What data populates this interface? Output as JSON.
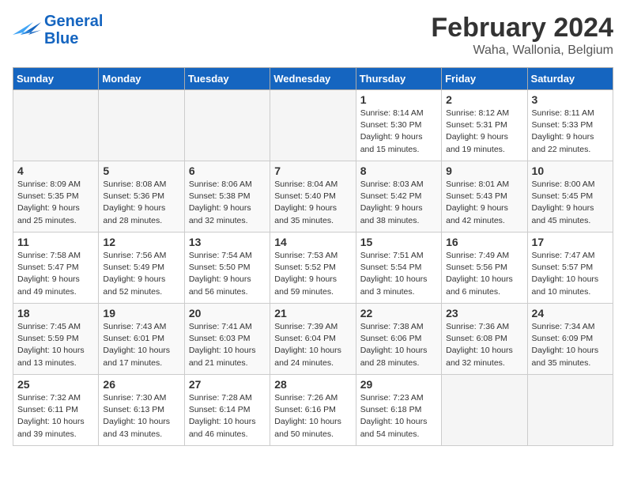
{
  "header": {
    "logo_line1": "General",
    "logo_line2": "Blue",
    "title": "February 2024",
    "subtitle": "Waha, Wallonia, Belgium"
  },
  "days_of_week": [
    "Sunday",
    "Monday",
    "Tuesday",
    "Wednesday",
    "Thursday",
    "Friday",
    "Saturday"
  ],
  "weeks": [
    [
      {
        "day": "",
        "info": ""
      },
      {
        "day": "",
        "info": ""
      },
      {
        "day": "",
        "info": ""
      },
      {
        "day": "",
        "info": ""
      },
      {
        "day": "1",
        "info": "Sunrise: 8:14 AM\nSunset: 5:30 PM\nDaylight: 9 hours\nand 15 minutes."
      },
      {
        "day": "2",
        "info": "Sunrise: 8:12 AM\nSunset: 5:31 PM\nDaylight: 9 hours\nand 19 minutes."
      },
      {
        "day": "3",
        "info": "Sunrise: 8:11 AM\nSunset: 5:33 PM\nDaylight: 9 hours\nand 22 minutes."
      }
    ],
    [
      {
        "day": "4",
        "info": "Sunrise: 8:09 AM\nSunset: 5:35 PM\nDaylight: 9 hours\nand 25 minutes."
      },
      {
        "day": "5",
        "info": "Sunrise: 8:08 AM\nSunset: 5:36 PM\nDaylight: 9 hours\nand 28 minutes."
      },
      {
        "day": "6",
        "info": "Sunrise: 8:06 AM\nSunset: 5:38 PM\nDaylight: 9 hours\nand 32 minutes."
      },
      {
        "day": "7",
        "info": "Sunrise: 8:04 AM\nSunset: 5:40 PM\nDaylight: 9 hours\nand 35 minutes."
      },
      {
        "day": "8",
        "info": "Sunrise: 8:03 AM\nSunset: 5:42 PM\nDaylight: 9 hours\nand 38 minutes."
      },
      {
        "day": "9",
        "info": "Sunrise: 8:01 AM\nSunset: 5:43 PM\nDaylight: 9 hours\nand 42 minutes."
      },
      {
        "day": "10",
        "info": "Sunrise: 8:00 AM\nSunset: 5:45 PM\nDaylight: 9 hours\nand 45 minutes."
      }
    ],
    [
      {
        "day": "11",
        "info": "Sunrise: 7:58 AM\nSunset: 5:47 PM\nDaylight: 9 hours\nand 49 minutes."
      },
      {
        "day": "12",
        "info": "Sunrise: 7:56 AM\nSunset: 5:49 PM\nDaylight: 9 hours\nand 52 minutes."
      },
      {
        "day": "13",
        "info": "Sunrise: 7:54 AM\nSunset: 5:50 PM\nDaylight: 9 hours\nand 56 minutes."
      },
      {
        "day": "14",
        "info": "Sunrise: 7:53 AM\nSunset: 5:52 PM\nDaylight: 9 hours\nand 59 minutes."
      },
      {
        "day": "15",
        "info": "Sunrise: 7:51 AM\nSunset: 5:54 PM\nDaylight: 10 hours\nand 3 minutes."
      },
      {
        "day": "16",
        "info": "Sunrise: 7:49 AM\nSunset: 5:56 PM\nDaylight: 10 hours\nand 6 minutes."
      },
      {
        "day": "17",
        "info": "Sunrise: 7:47 AM\nSunset: 5:57 PM\nDaylight: 10 hours\nand 10 minutes."
      }
    ],
    [
      {
        "day": "18",
        "info": "Sunrise: 7:45 AM\nSunset: 5:59 PM\nDaylight: 10 hours\nand 13 minutes."
      },
      {
        "day": "19",
        "info": "Sunrise: 7:43 AM\nSunset: 6:01 PM\nDaylight: 10 hours\nand 17 minutes."
      },
      {
        "day": "20",
        "info": "Sunrise: 7:41 AM\nSunset: 6:03 PM\nDaylight: 10 hours\nand 21 minutes."
      },
      {
        "day": "21",
        "info": "Sunrise: 7:39 AM\nSunset: 6:04 PM\nDaylight: 10 hours\nand 24 minutes."
      },
      {
        "day": "22",
        "info": "Sunrise: 7:38 AM\nSunset: 6:06 PM\nDaylight: 10 hours\nand 28 minutes."
      },
      {
        "day": "23",
        "info": "Sunrise: 7:36 AM\nSunset: 6:08 PM\nDaylight: 10 hours\nand 32 minutes."
      },
      {
        "day": "24",
        "info": "Sunrise: 7:34 AM\nSunset: 6:09 PM\nDaylight: 10 hours\nand 35 minutes."
      }
    ],
    [
      {
        "day": "25",
        "info": "Sunrise: 7:32 AM\nSunset: 6:11 PM\nDaylight: 10 hours\nand 39 minutes."
      },
      {
        "day": "26",
        "info": "Sunrise: 7:30 AM\nSunset: 6:13 PM\nDaylight: 10 hours\nand 43 minutes."
      },
      {
        "day": "27",
        "info": "Sunrise: 7:28 AM\nSunset: 6:14 PM\nDaylight: 10 hours\nand 46 minutes."
      },
      {
        "day": "28",
        "info": "Sunrise: 7:26 AM\nSunset: 6:16 PM\nDaylight: 10 hours\nand 50 minutes."
      },
      {
        "day": "29",
        "info": "Sunrise: 7:23 AM\nSunset: 6:18 PM\nDaylight: 10 hours\nand 54 minutes."
      },
      {
        "day": "",
        "info": ""
      },
      {
        "day": "",
        "info": ""
      }
    ]
  ]
}
